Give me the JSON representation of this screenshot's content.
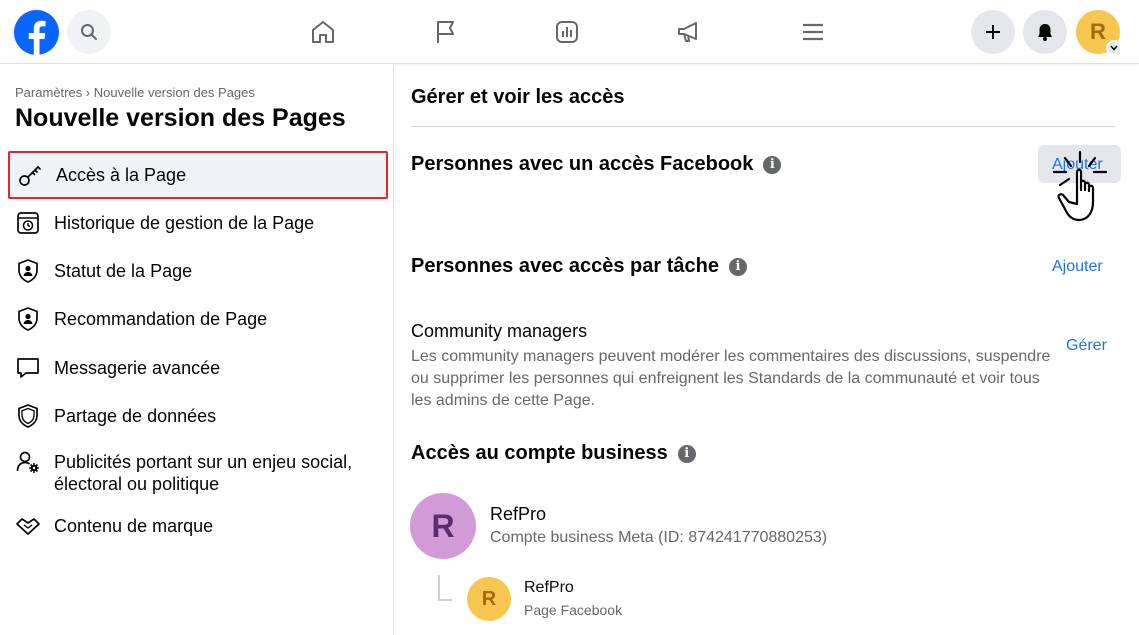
{
  "topbar": {
    "logo_icon": "facebook-logo",
    "search_icon": "search-icon",
    "nav_icons": [
      "home-icon",
      "flag-icon",
      "insights-icon",
      "megaphone-icon",
      "menu-icon"
    ],
    "actions": [
      "plus-icon",
      "bell-icon"
    ],
    "avatar_letter": "R"
  },
  "sidebar": {
    "breadcrumb": "Paramètres › Nouvelle version des Pages",
    "title": "Nouvelle version des Pages",
    "items": [
      {
        "label": "Accès à la Page",
        "icon": "key-icon"
      },
      {
        "label": "Historique de gestion de la Page",
        "icon": "history-icon"
      },
      {
        "label": "Statut de la Page",
        "icon": "shield-person-icon"
      },
      {
        "label": "Recommandation de Page",
        "icon": "shield-person-icon"
      },
      {
        "label": "Messagerie avancée",
        "icon": "message-icon"
      },
      {
        "label": "Partage de données",
        "icon": "shield-icon"
      },
      {
        "label_line1": "Publicités portant sur un enjeu social,",
        "label_line2": "électoral ou politique",
        "icon": "person-gear-icon"
      },
      {
        "label": "Contenu de marque",
        "icon": "handshake-icon"
      }
    ]
  },
  "main": {
    "header": "Gérer et voir les accès",
    "facebook_access": {
      "title": "Personnes avec un accès Facebook",
      "action": "Ajouter"
    },
    "task_access": {
      "title": "Personnes avec accès par tâche",
      "action": "Ajouter"
    },
    "community": {
      "title": "Community managers",
      "description": "Les community managers peuvent modérer les commentaires des discussions, suspendre ou supprimer les personnes qui enfreignent les Standards de la communauté et voir tous les admins de cette Page.",
      "action": "Gérer"
    },
    "business": {
      "title": "Accès au compte business",
      "account": {
        "letter": "R",
        "name": "RefPro",
        "subtitle": "Compte business Meta (ID: 874241770880253)"
      },
      "page": {
        "letter": "R",
        "name": "RefPro",
        "subtitle": "Page Facebook"
      }
    },
    "info_glyph": "i"
  },
  "colors": {
    "accent": "#1b74e4",
    "highlight_border": "#e4242f",
    "fb_blue": "#0866ff"
  }
}
